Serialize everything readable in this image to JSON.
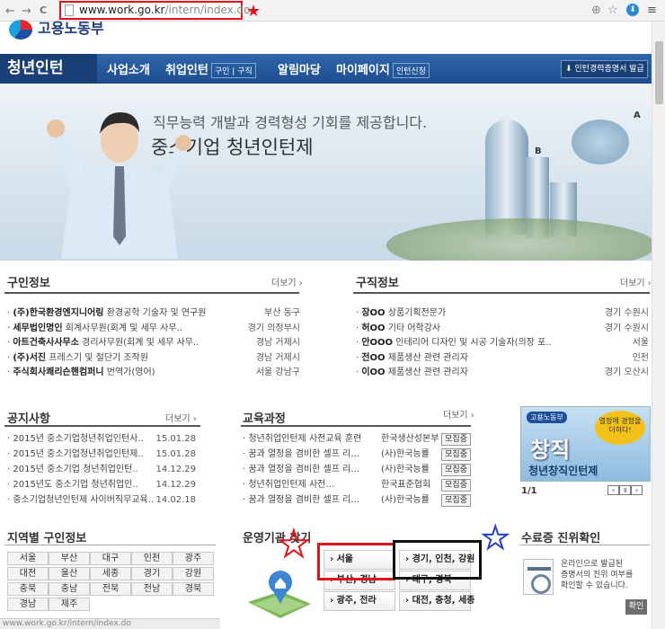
{
  "browser": {
    "back": "←",
    "forward": "→",
    "reload": "C",
    "url_host": "www.work.go.kr",
    "url_path": "/intern/index.do",
    "status_url": "www.work.go.kr/intern/index.do"
  },
  "logo": {
    "text": "고용노동부"
  },
  "gnb": {
    "brand": "청년인턴",
    "menu": [
      "사업소개",
      "취업인턴",
      "알림마당",
      "마이페이지"
    ],
    "sub1": "구인",
    "sub2": "구직",
    "sub3": "인턴신청",
    "cert": "인턴경력증명서 발급"
  },
  "hero": {
    "line1": "직무능력 개발과 경력형성 기회를 제공합니다.",
    "line2": "중소기업 청년인턴제",
    "labelA": "A",
    "labelB": "B"
  },
  "job_offers": {
    "title": "구인정보",
    "more": "더보기 ›",
    "rows": [
      {
        "company": "(주)한국환경엔지니어링",
        "job": "환경공학 기술자 및 연구원",
        "loc": "부산 동구"
      },
      {
        "company": "세무법인명인",
        "job": "회계사무원(회계 및 세무 사무..",
        "loc": "경기 의정부시"
      },
      {
        "company": "아트건축사사무소",
        "job": "경리사무원(회계 및 세무 사무..",
        "loc": "경남 거제시"
      },
      {
        "company": "(주)서진",
        "job": "프레스기 및 절단기 조작원",
        "loc": "경남 거제시"
      },
      {
        "company": "주식회사쾌리슨핸컴퍼니",
        "job": "번역가(영어)",
        "loc": "서울 강남구"
      }
    ]
  },
  "job_seekers": {
    "title": "구직정보",
    "more": "더보기 ›",
    "rows": [
      {
        "name": "장OO",
        "job": "상품기획전문가",
        "loc": "경기 수원시"
      },
      {
        "name": "허OO",
        "job": "기타 어학강사",
        "loc": "경기 수원시"
      },
      {
        "name": "안OOO",
        "job": "인테리어 디자인 및 시공 기술자(의장 포..",
        "loc": "서울"
      },
      {
        "name": "전OO",
        "job": "제품생산 관련 관리자",
        "loc": "인천"
      },
      {
        "name": "이OO",
        "job": "제품생산 관련 관리자",
        "loc": "경기 오산시"
      }
    ]
  },
  "notices": {
    "title": "공지사항",
    "more": "더보기 ›",
    "rows": [
      {
        "text": "2015년 중소기업청년취업인턴사..",
        "date": "15.01.28"
      },
      {
        "text": "2015년 중소기업청년취업인턴제..",
        "date": "15.01.28"
      },
      {
        "text": "2015년 중소기업 청년취업인턴..",
        "date": "14.12.29"
      },
      {
        "text": "2015년도 중소기업 청년취업인..",
        "date": "14.12.29"
      },
      {
        "text": "중소기업청년인턴제 사이버직무교육..",
        "date": "14.02.18"
      }
    ]
  },
  "education": {
    "title": "교육과정",
    "more": "더보기 ›",
    "rows": [
      {
        "text": "청년취업인턴제 사전교육 훈련",
        "org": "한국생산성본부",
        "badge": "모집중"
      },
      {
        "text": "꿈과 열정을 겸비한 셀프 리…",
        "org": "(사)한국능률",
        "badge": "모집중"
      },
      {
        "text": "꿈과 열정을 겸비한 셀프 리…",
        "org": "(사)한국능률",
        "badge": "모집중"
      },
      {
        "text": "청년취업인턴제 사전…",
        "org": "한국표준협회",
        "badge": "모집중"
      },
      {
        "text": "꿈과 열정을 겸비한 셀프 리…",
        "org": "(사)한국능률",
        "badge": "모집중"
      }
    ]
  },
  "banner": {
    "ministry": "고용노동부",
    "bubble": "열정에 경험을 더하다!",
    "big": "창직",
    "slogan": "청년창직인턴제",
    "pager": "1/1"
  },
  "regions": {
    "title": "지역별 구인정보",
    "items": [
      "서울",
      "부산",
      "대구",
      "인천",
      "광주",
      "대전",
      "울산",
      "세종",
      "경기",
      "강원",
      "충북",
      "충남",
      "전북",
      "전남",
      "경북",
      "경남",
      "제주"
    ]
  },
  "operators": {
    "title": "운영기관 찾기",
    "items": [
      "서울",
      "경기, 인천, 강원",
      "부산, 경남",
      "대구, 경북",
      "광주, 전라",
      "대전, 충청, 세종"
    ]
  },
  "completion": {
    "title": "수료증 진위확인",
    "desc1": "온라인으로 발급된",
    "desc2": "증명서의 진위 여부를",
    "desc3": "확인할 수 있습니다.",
    "button": "확인"
  },
  "colors": {
    "nav_blue": "#2a5da0",
    "mark_red": "#e0141b",
    "mark_blue": "#2b3fc6"
  }
}
